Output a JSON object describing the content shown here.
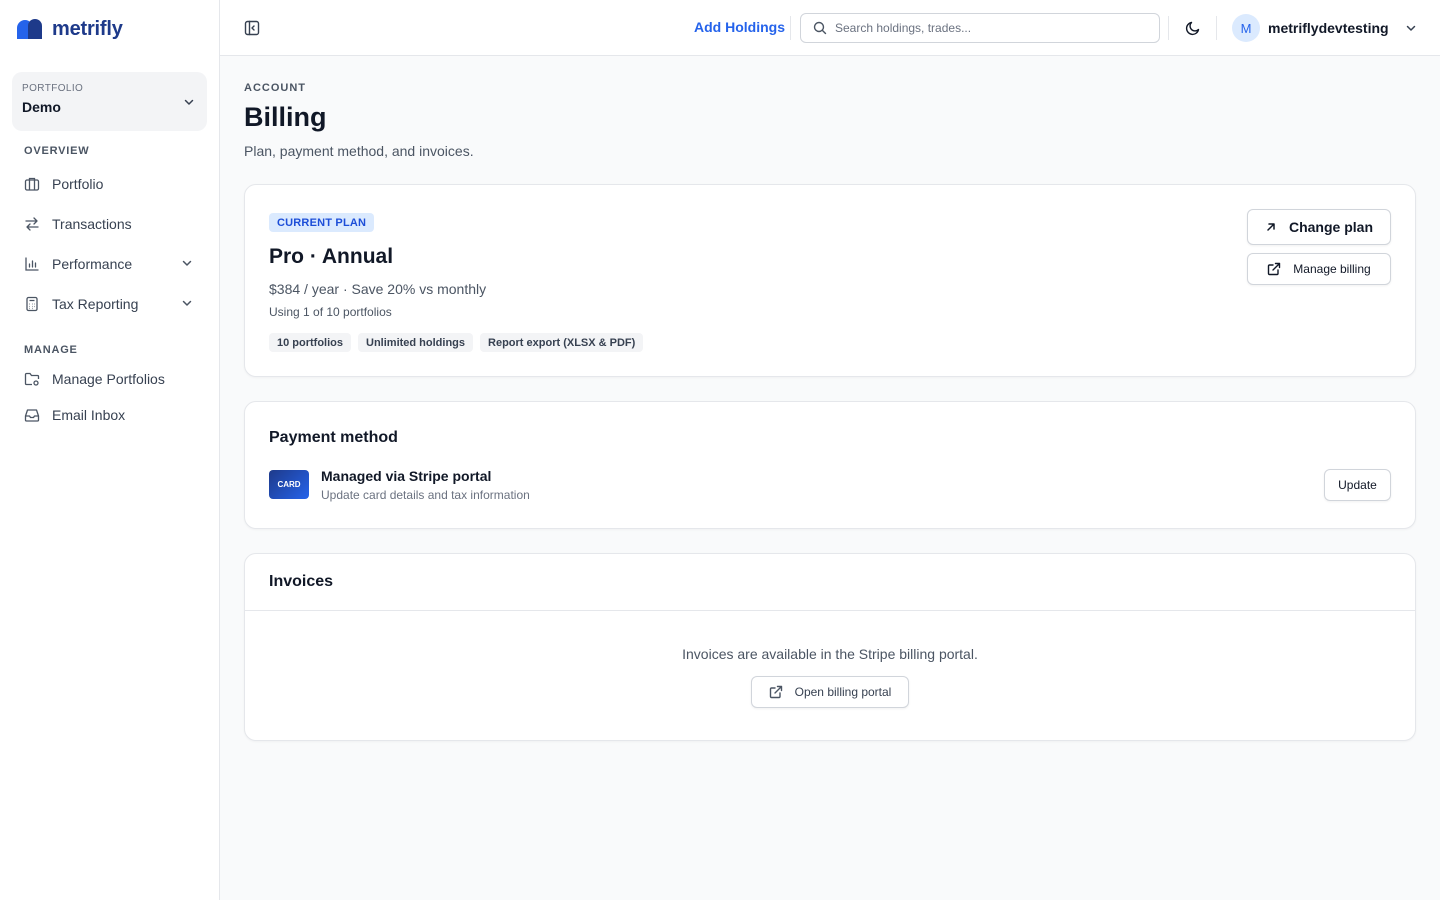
{
  "brand": {
    "name": "metrifly",
    "primary": "#1e3a8a",
    "accent": "#2563eb"
  },
  "sidebar": {
    "portfolio_label": "PORTFOLIO",
    "portfolio_value": "Demo",
    "sections": {
      "overview": "OVERVIEW",
      "manage": "MANAGE"
    },
    "items": [
      {
        "label": "Portfolio",
        "icon": "briefcase-icon"
      },
      {
        "label": "Transactions",
        "icon": "arrows-exchange-icon"
      },
      {
        "label": "Performance",
        "icon": "bar-chart-icon"
      },
      {
        "label": "Tax Reporting",
        "icon": "calculator-icon"
      },
      {
        "label": "Manage Portfolios",
        "icon": "folder-settings-icon"
      },
      {
        "label": "Email Inbox",
        "icon": "inbox-icon"
      }
    ]
  },
  "topbar": {
    "add_holdings": "Add Holdings",
    "search_placeholder": "Search holdings, trades...",
    "avatar_initial": "M",
    "username": "metriflydevtesting"
  },
  "page": {
    "eyebrow": "ACCOUNT",
    "title": "Billing",
    "subtitle": "Plan, payment method, and invoices."
  },
  "plan": {
    "badge": "CURRENT PLAN",
    "name": "Pro · Annual",
    "price": "$384 / year · Save 20% vs monthly",
    "usage": "Using 1 of 10 portfolios",
    "features": [
      "10 portfolios",
      "Unlimited holdings",
      "Report export (XLSX & PDF)"
    ],
    "change_plan": "Change plan",
    "manage_billing": "Manage billing"
  },
  "payment": {
    "title": "Payment method",
    "card_label": "CARD",
    "method_title": "Managed via Stripe portal",
    "method_sub": "Update card details and tax information",
    "update": "Update"
  },
  "invoices": {
    "title": "Invoices",
    "message": "Invoices are available in the Stripe billing portal.",
    "open_portal": "Open billing portal"
  }
}
